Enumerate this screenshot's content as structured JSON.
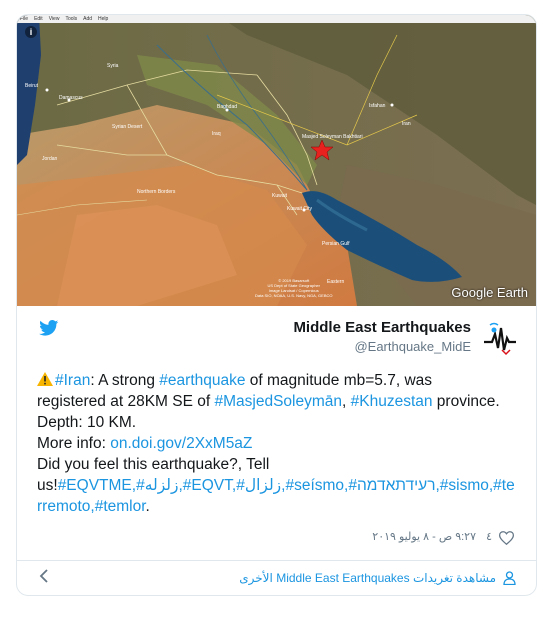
{
  "map": {
    "menu_items": [
      "File",
      "Edit",
      "View",
      "Tools",
      "Add",
      "Help"
    ],
    "place_labels": {
      "syria": "Syria",
      "beirut": "Beirut",
      "damascus": "Damascus",
      "baghdad": "Baghdad",
      "iraq": "Iraq",
      "jordan": "Jordan",
      "syrian_desert": "Syrian Desert",
      "northern_borders": "Northern Borders",
      "kuwait": "Kuwait",
      "kuwait_city": "Kuwait City",
      "persian_gulf": "Persian Gulf",
      "isfahan": "Isfahan",
      "iran": "Iran",
      "masjed": "Masjed Soleyman Bakhtiari",
      "eastern": "Eastern"
    },
    "copyright_lines": [
      "© 2019 Basarsoft",
      "US Dept of State Geographer",
      "Image Landsat / Copernicus",
      "Data SIO, NOAA, U.S. Navy, NGA, GEBCO"
    ],
    "google_earth": "Google Earth",
    "marker_icon": "red-star-icon"
  },
  "author": {
    "name": "Middle East Earthquakes",
    "handle": "@Earthquake_MidE"
  },
  "tweet": {
    "line1_pre": ":",
    "hashtag_iran": "#Iran",
    "line1_mid": " A strong ",
    "hashtag_earthquake": "#earthquake",
    "line1_post": " of magnitude mb=5.7, was",
    "line2_pre": "registered at 28KM SE of ",
    "hashtag_masjed": "#MasjedSoleymān",
    "line2_mid": ", ",
    "hashtag_khuzestan": "#Khuzestan",
    "line2_post": " province.",
    "line3": "Depth: 10 KM.",
    "line4_pre": "More info: ",
    "link": "on.doi.gov/2XxM5aZ",
    "line5": "Did you feel this earthquake?, Tell",
    "line6_pre": "us!",
    "line6_tags": "#EQVTME,#زلزله,#EQVT,#زلزال,#seísmo,#רעידתאדמה,#sismo,#te",
    "line7_tags": "rremoto,#temlor",
    "line7_post": "."
  },
  "meta": {
    "likes": "٤",
    "timestamp": "٩:٢٧ ص - ٨ يوليو ٢٠١٩"
  },
  "footer": {
    "text": "مشاهدة تغريدات Middle East Earthquakes الأخرى"
  },
  "colors": {
    "link": "#1b95e0",
    "twitter_blue": "#1da1f2",
    "secondary_text": "#657786"
  }
}
